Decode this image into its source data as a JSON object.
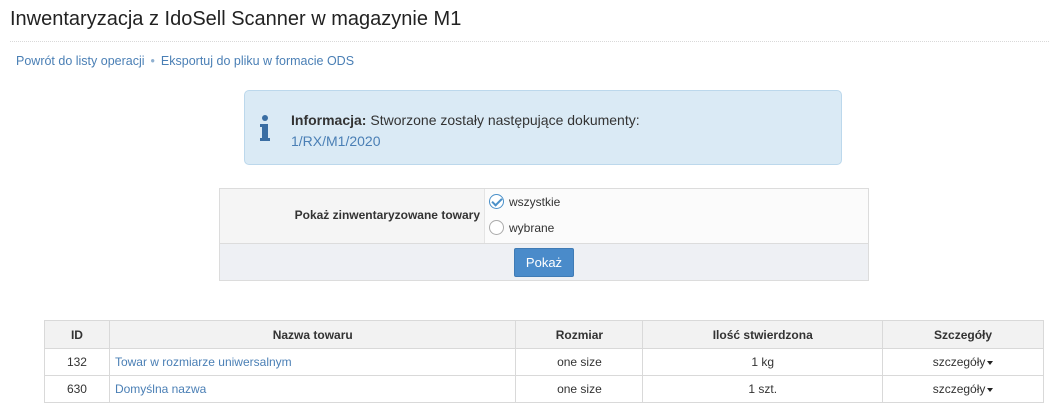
{
  "page": {
    "title": "Inwentaryzacja z IdoSell Scanner w magazynie M1"
  },
  "actions": {
    "back_label": "Powrót do listy operacji",
    "separator": "•",
    "export_label": "Eksportuj do pliku w formacie ODS"
  },
  "info": {
    "icon": "info-icon",
    "heading": "Informacja:",
    "message": "Stworzone zostały następujące dokumenty:",
    "document_link": "1/RX/M1/2020"
  },
  "filter": {
    "label": "Pokaż zinwentaryzowane towary",
    "options": [
      {
        "label": "wszystkie",
        "checked": true
      },
      {
        "label": "wybrane",
        "checked": false
      }
    ],
    "submit_label": "Pokaż"
  },
  "table": {
    "headers": [
      "ID",
      "Nazwa towaru",
      "Rozmiar",
      "Ilość stwierdzona",
      "Szczegóły"
    ],
    "rows": [
      {
        "id": "132",
        "name": "Towar w rozmiarze uniwersalnym",
        "size": "one size",
        "quantity": "1 kg",
        "details": "szczegóły"
      },
      {
        "id": "630",
        "name": "Domyślna nazwa",
        "size": "one size",
        "quantity": "1 szt.",
        "details": "szczegóły"
      }
    ]
  },
  "colors": {
    "link": "#4a7fb5",
    "info_background": "#daeaf5",
    "button": "#4a8bca"
  }
}
